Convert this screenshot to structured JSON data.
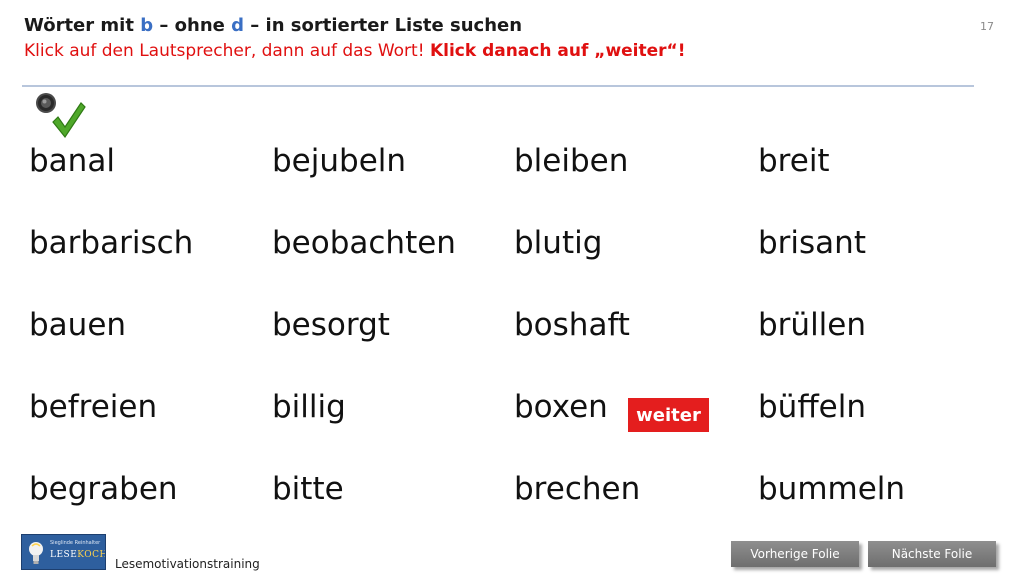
{
  "header": {
    "title_part1": "Wörter mit ",
    "title_letter_b": "b",
    "title_part2": " – ohne ",
    "title_letter_d": "d",
    "title_part3": " – in sortierter Liste suchen",
    "subtitle_plain": "Klick auf den Lautsprecher, dann auf das Wort! ",
    "subtitle_bold": "Klick danach auf „weiter“!",
    "slide_number": "17"
  },
  "icons": {
    "speaker": "speaker-icon",
    "check": "checkmark-icon"
  },
  "words": {
    "col1": [
      "banal",
      "barbarisch",
      "bauen",
      "befreien",
      "begraben"
    ],
    "col2": [
      "bejubeln",
      "beobachten",
      "besorgt",
      "billig",
      "bitte"
    ],
    "col3": [
      "bleiben",
      "blutig",
      "boshaft",
      "boxen",
      "brechen"
    ],
    "col4": [
      "breit",
      "brisant",
      "brüllen",
      "büffeln",
      "bummeln"
    ]
  },
  "weiter_button": {
    "label": "weiter"
  },
  "footer": {
    "logo_small_text": "Sieglinde Reinhalter",
    "logo_big_prefix": "LESE",
    "logo_big_suffix": "KOCH",
    "label": "Lesemotivationstraining",
    "prev_button": "Vorherige  Folie",
    "next_button": "Nächste  Folie"
  },
  "colors": {
    "title_accent": "#3a6fc4",
    "instruction_red": "#e01010",
    "weiter_red": "#e41e1e",
    "nav_gray": "#7d7d7d"
  }
}
